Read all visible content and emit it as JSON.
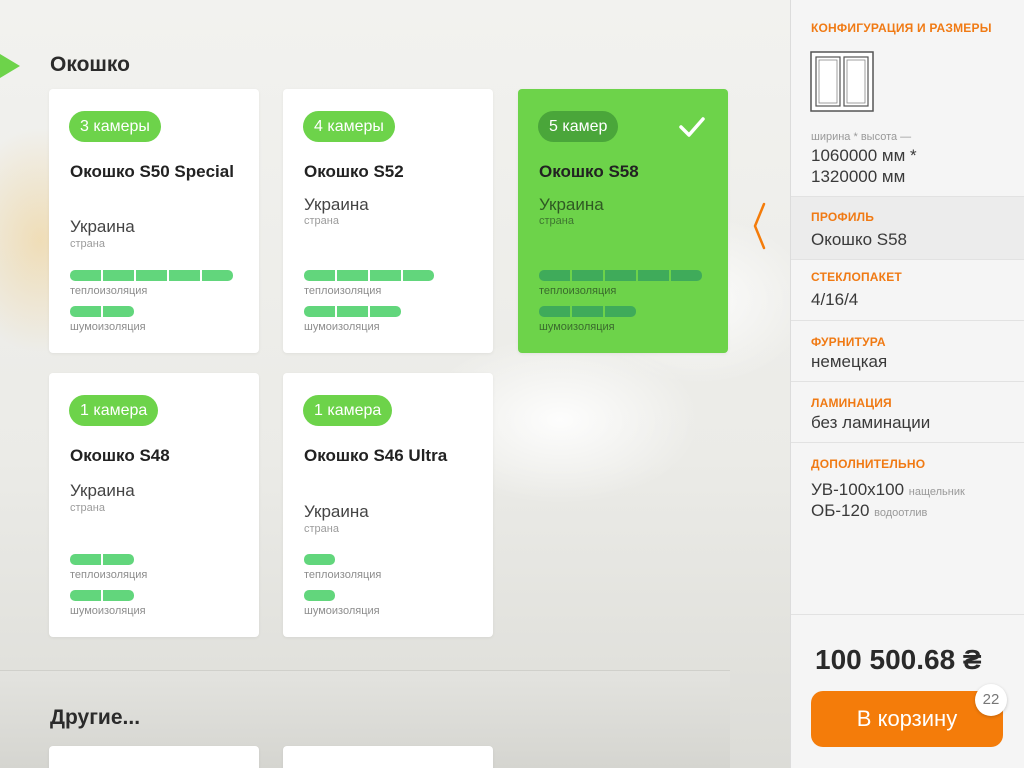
{
  "section": {
    "title": "Окошко",
    "other_title": "Другие..."
  },
  "cards": [
    {
      "badge": "3 камеры",
      "name": "Окошко S50 Special",
      "country": "Украина",
      "country_label": "страна",
      "thermal_label": "теплоизоляция",
      "noise_label": "шумоизоляция",
      "thermal": 5,
      "noise": 2,
      "selected": false
    },
    {
      "badge": "4 камеры",
      "name": "Окошко S52",
      "country": "Украина",
      "country_label": "страна",
      "thermal_label": "теплоизоляция",
      "noise_label": "шумоизоляция",
      "thermal": 4,
      "noise": 3,
      "selected": false
    },
    {
      "badge": "5 камер",
      "name": "Окошко S58",
      "country": "Украина",
      "country_label": "страна",
      "thermal_label": "теплоизоляция",
      "noise_label": "шумоизоляция",
      "thermal": 5,
      "noise": 3,
      "selected": true
    },
    {
      "badge": "1 камера",
      "name": "Окошко S48",
      "country": "Украина",
      "country_label": "страна",
      "thermal_label": "теплоизоляция",
      "noise_label": "шумоизоляция",
      "thermal": 2,
      "noise": 2,
      "selected": false
    },
    {
      "badge": "1 камера",
      "name": "Окошко S46 Ultra",
      "country": "Украина",
      "country_label": "страна",
      "thermal_label": "теплоизоляция",
      "noise_label": "шумоизоляция",
      "thermal": 1,
      "noise": 1,
      "selected": false
    }
  ],
  "side": {
    "config_head": "КОНФИГУРАЦИЯ И РАЗМЕРЫ",
    "size_label": "ширина * высота —",
    "size_line1": "1060000 мм *",
    "size_line2": "1320000 мм",
    "profile_head": "ПРОФИЛЬ",
    "profile_val": "Окошко S58",
    "glass_head": "СТЕКЛОПАКЕТ",
    "glass_val": "4/16/4",
    "hardware_head": "ФУРНИТУРА",
    "hardware_val": "немецкая",
    "lamination_head": "ЛАМИНАЦИЯ",
    "lamination_val": "без ламинации",
    "extra_head": "ДОПОЛНИТЕЛЬНО",
    "extra1_val": "УВ-100х100",
    "extra1_note": "нащельник",
    "extra2_val": "ОБ-120",
    "extra2_note": "водоотлив",
    "price": "100 500.68 ₴",
    "cart_label": "В корзину",
    "cart_count": "22"
  },
  "colors": {
    "accent_green": "#6dd34a",
    "accent_orange": "#f47c0a",
    "bar_green": "#62d67c"
  },
  "icons": {
    "check": "check-icon",
    "window": "window-config-icon",
    "collapse": "chevron-left-icon"
  }
}
